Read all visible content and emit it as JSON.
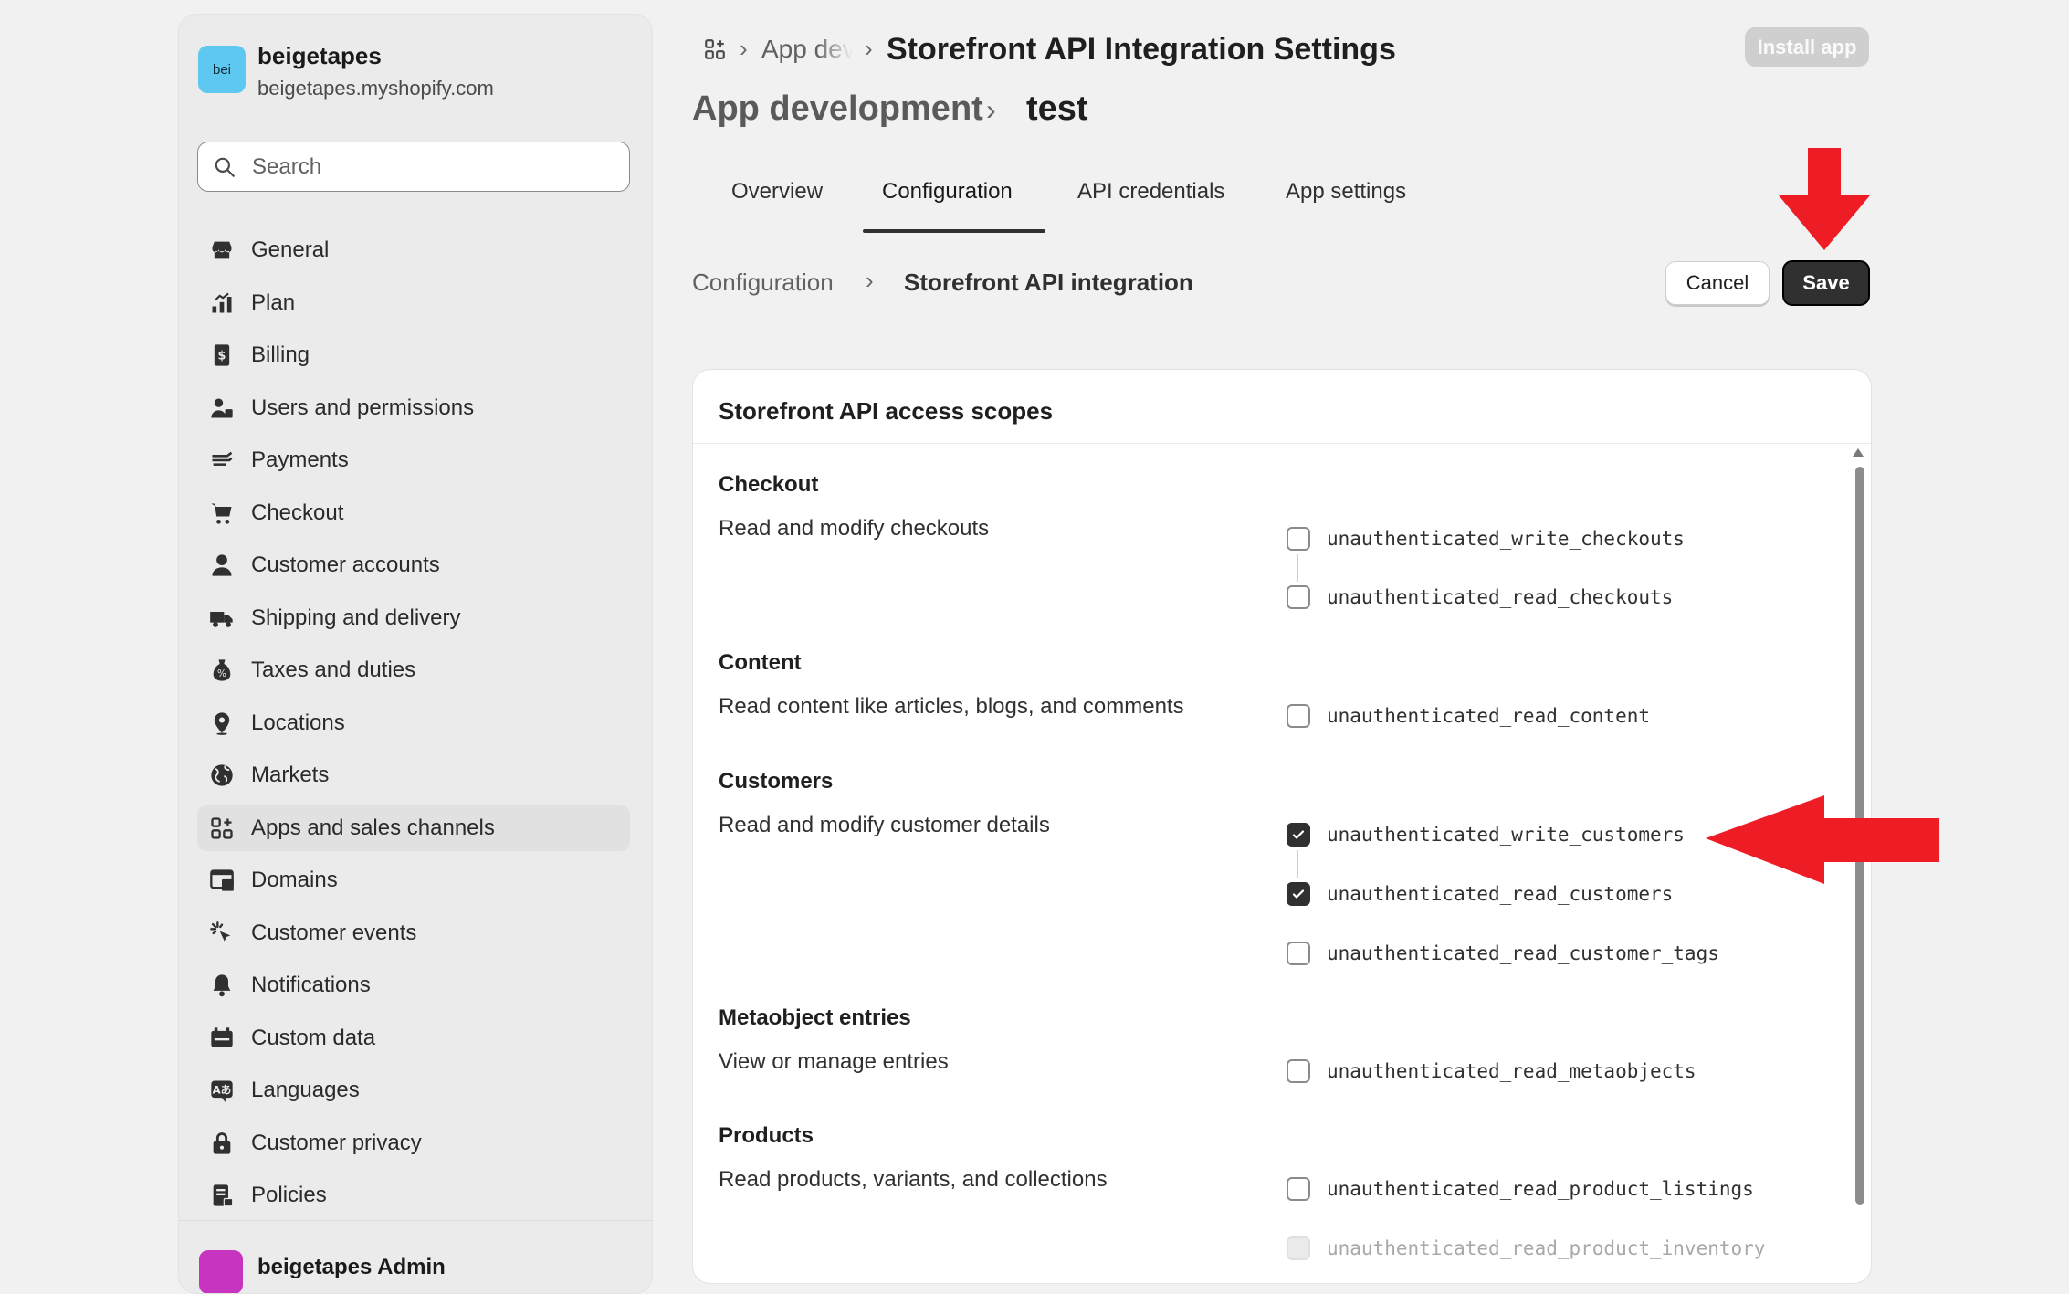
{
  "store": {
    "avatar_text": "bei",
    "name": "beigetapes",
    "domain": "beigetapes.myshopify.com"
  },
  "search": {
    "placeholder": "Search",
    "value": ""
  },
  "sidebar": {
    "items": [
      {
        "label": "General",
        "icon": "store-icon"
      },
      {
        "label": "Plan",
        "icon": "plan-icon"
      },
      {
        "label": "Billing",
        "icon": "billing-icon"
      },
      {
        "label": "Users and permissions",
        "icon": "users-icon"
      },
      {
        "label": "Payments",
        "icon": "payments-icon"
      },
      {
        "label": "Checkout",
        "icon": "cart-icon"
      },
      {
        "label": "Customer accounts",
        "icon": "person-icon"
      },
      {
        "label": "Shipping and delivery",
        "icon": "truck-icon"
      },
      {
        "label": "Taxes and duties",
        "icon": "tax-icon"
      },
      {
        "label": "Locations",
        "icon": "location-icon"
      },
      {
        "label": "Markets",
        "icon": "globe-icon"
      },
      {
        "label": "Apps and sales channels",
        "icon": "apps-icon",
        "active": true
      },
      {
        "label": "Domains",
        "icon": "domains-icon"
      },
      {
        "label": "Customer events",
        "icon": "cursor-click-icon"
      },
      {
        "label": "Notifications",
        "icon": "bell-icon"
      },
      {
        "label": "Custom data",
        "icon": "custom-data-icon"
      },
      {
        "label": "Languages",
        "icon": "language-icon"
      },
      {
        "label": "Customer privacy",
        "icon": "lock-icon"
      },
      {
        "label": "Policies",
        "icon": "policies-icon"
      }
    ],
    "footer_name": "beigetapes Admin"
  },
  "breadcrumb": {
    "parent": "App dev",
    "title": "Storefront API Integration Settings"
  },
  "header": {
    "install_label": "Install app",
    "app_development": "App development",
    "app_name": "test"
  },
  "tabs": [
    {
      "label": "Overview"
    },
    {
      "label": "Configuration",
      "active": true
    },
    {
      "label": "API credentials"
    },
    {
      "label": "App settings"
    }
  ],
  "subheader": {
    "parent": "Configuration",
    "current": "Storefront API integration",
    "cancel_label": "Cancel",
    "save_label": "Save"
  },
  "card": {
    "title": "Storefront API access scopes",
    "groups": [
      {
        "title": "Checkout",
        "description": "Read and modify checkouts",
        "scopes": [
          {
            "name": "unauthenticated_write_checkouts",
            "checked": false
          },
          {
            "name": "unauthenticated_read_checkouts",
            "checked": false
          }
        ]
      },
      {
        "title": "Content",
        "description": "Read content like articles, blogs, and comments",
        "scopes": [
          {
            "name": "unauthenticated_read_content",
            "checked": false
          }
        ]
      },
      {
        "title": "Customers",
        "description": "Read and modify customer details",
        "scopes": [
          {
            "name": "unauthenticated_write_customers",
            "checked": true
          },
          {
            "name": "unauthenticated_read_customers",
            "checked": true
          },
          {
            "name": "unauthenticated_read_customer_tags",
            "checked": false
          }
        ]
      },
      {
        "title": "Metaobject entries",
        "description": "View or manage entries",
        "scopes": [
          {
            "name": "unauthenticated_read_metaobjects",
            "checked": false
          }
        ]
      },
      {
        "title": "Products",
        "description": "Read products, variants, and collections",
        "scopes": [
          {
            "name": "unauthenticated_read_product_listings",
            "checked": false
          },
          {
            "name": "unauthenticated_read_product_inventory",
            "checked": false,
            "disabled": true
          }
        ]
      }
    ]
  },
  "colors": {
    "accent_dark": "#303030",
    "annotation_arrow": "#ee1c24",
    "store_avatar": "#5ec8f0",
    "admin_avatar": "#c735c0"
  }
}
